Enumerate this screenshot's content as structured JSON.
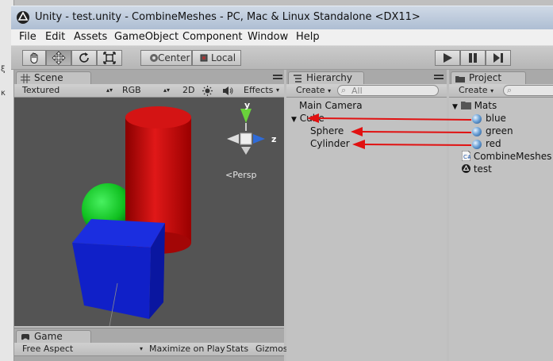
{
  "window": {
    "title": "Unity - test.unity - CombineMeshes - PC, Mac & Linux Standalone <DX11>"
  },
  "menu": [
    "File",
    "Edit",
    "Assets",
    "GameObject",
    "Component",
    "Window",
    "Help"
  ],
  "toolbar": {
    "pivot_label": "Center",
    "space_label": "Local"
  },
  "scene": {
    "tab_label": "Scene",
    "shading_mode": "Textured",
    "render_mode": "RGB",
    "mode_2d": "2D",
    "effects_label": "Effects",
    "gizmo_y": "y",
    "gizmo_z": "z",
    "persp_label": "Persp"
  },
  "game": {
    "tab_label": "Game",
    "aspect": "Free Aspect",
    "maximize_label": "Maximize on Play",
    "stats_label": "Stats",
    "gizmos_label": "Gizmos"
  },
  "hierarchy": {
    "tab_label": "Hierarchy",
    "create_label": "Create",
    "search_placeholder": "All",
    "items": [
      "Main Camera",
      "Cube",
      "Sphere",
      "Cylinder"
    ]
  },
  "project": {
    "tab_label": "Project",
    "create_label": "Create",
    "folder": "Mats",
    "materials": [
      "blue",
      "green",
      "red"
    ],
    "assets": [
      "CombineMeshes",
      "test"
    ]
  },
  "colors": {
    "arrow": "#e11111",
    "cylinder": "#cc1111",
    "sphere": "#10c020",
    "cube": "#1020c8",
    "scene_bg": "#545454"
  }
}
